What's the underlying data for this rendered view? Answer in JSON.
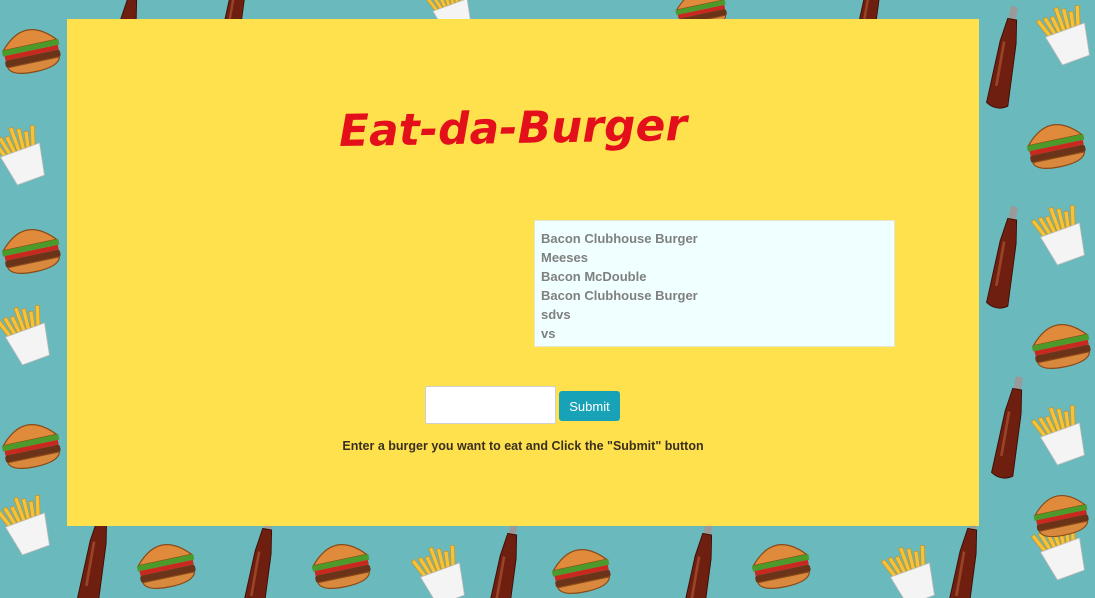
{
  "page": {
    "title": "Eat-da-Burger",
    "title_color": "#e3101b",
    "panel_color": "#ffe14d",
    "background_color": "#6ab9bd",
    "background_pattern_icons": [
      "fries-icon",
      "burger-icon",
      "soda-bottle-icon"
    ]
  },
  "burger_list": {
    "items": [
      "Bacon Clubhouse Burger",
      "Meeses",
      "Bacon McDouble",
      "Bacon Clubhouse Burger",
      "sdvs",
      "vs"
    ]
  },
  "form": {
    "input_value": "",
    "submit_label": "Submit",
    "button_color": "#17a2b8",
    "instructions": "Enter a burger you want to eat and Click the \"Submit\" button"
  }
}
